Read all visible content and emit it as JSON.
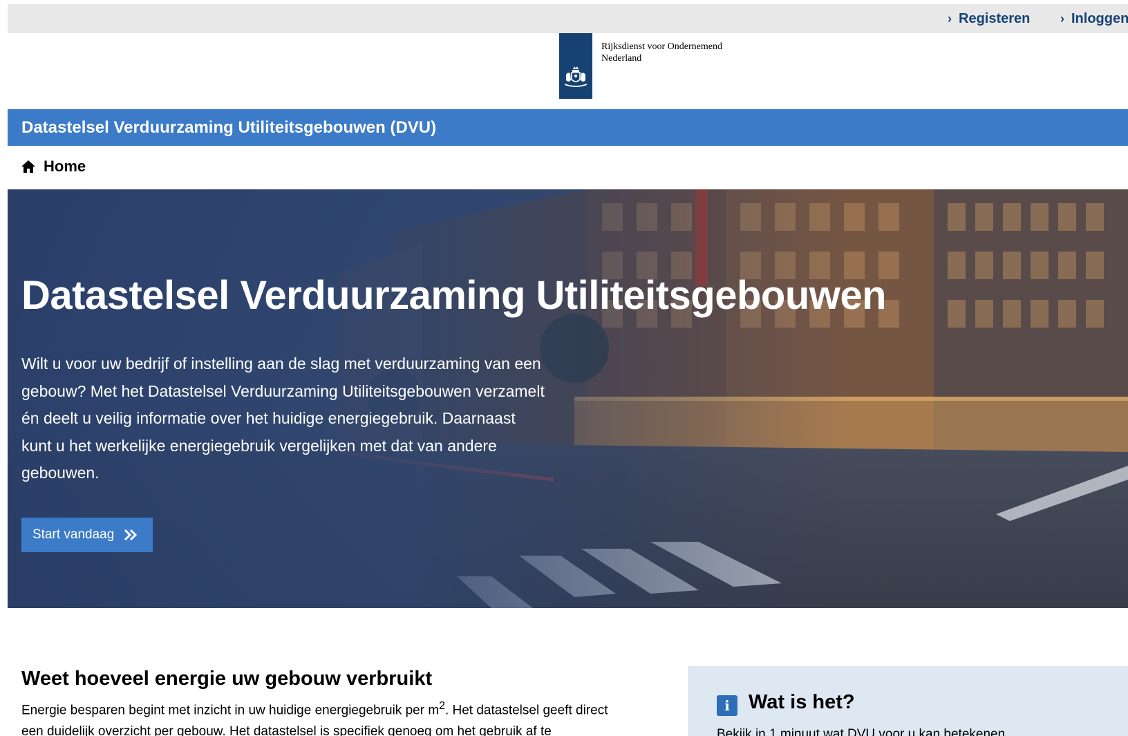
{
  "utility_nav": {
    "register_label": "Registeren",
    "login_label": "Inloggen"
  },
  "logo": {
    "organisation_name": "Rijksdienst voor Ondernemend Nederland",
    "brand_color": "#154273"
  },
  "site_title_bar": {
    "title": "Datastelsel Verduurzaming Utiliteitsgebouwen (DVU)",
    "color": "#3b7bc8"
  },
  "breadcrumb": {
    "home_label": "Home"
  },
  "hero": {
    "title": "Datastelsel Verduurzaming Utiliteitsgebouwen",
    "text": "Wilt u voor uw bedrijf of instelling aan de slag met verduurzaming van een gebouw? Met het Datastelsel Verduurzaming Utiliteitsgebouwen verzamelt én deelt u veilig informatie over het huidige energiegebruik. Daarnaast kunt u het werkelijke energiegebruik vergelijken met dat van andere gebouwen.",
    "button_label": "Start vandaag"
  },
  "main": {
    "heading": "Weet hoeveel energie uw gebouw verbruikt",
    "text_before_sup": "Energie besparen begint met inzicht in uw huidige energiegebruik per m",
    "sup": "2",
    "text_after_sup": ". Het datastelsel geeft direct een duidelijk overzicht per gebouw. Het datastelsel is specifiek genoeg om het gebruik af te"
  },
  "info_panel": {
    "icon": "info-icon",
    "title": "Wat is het?",
    "text": "Bekijk in 1 minuut wat DVU voor u kan betekenen."
  }
}
